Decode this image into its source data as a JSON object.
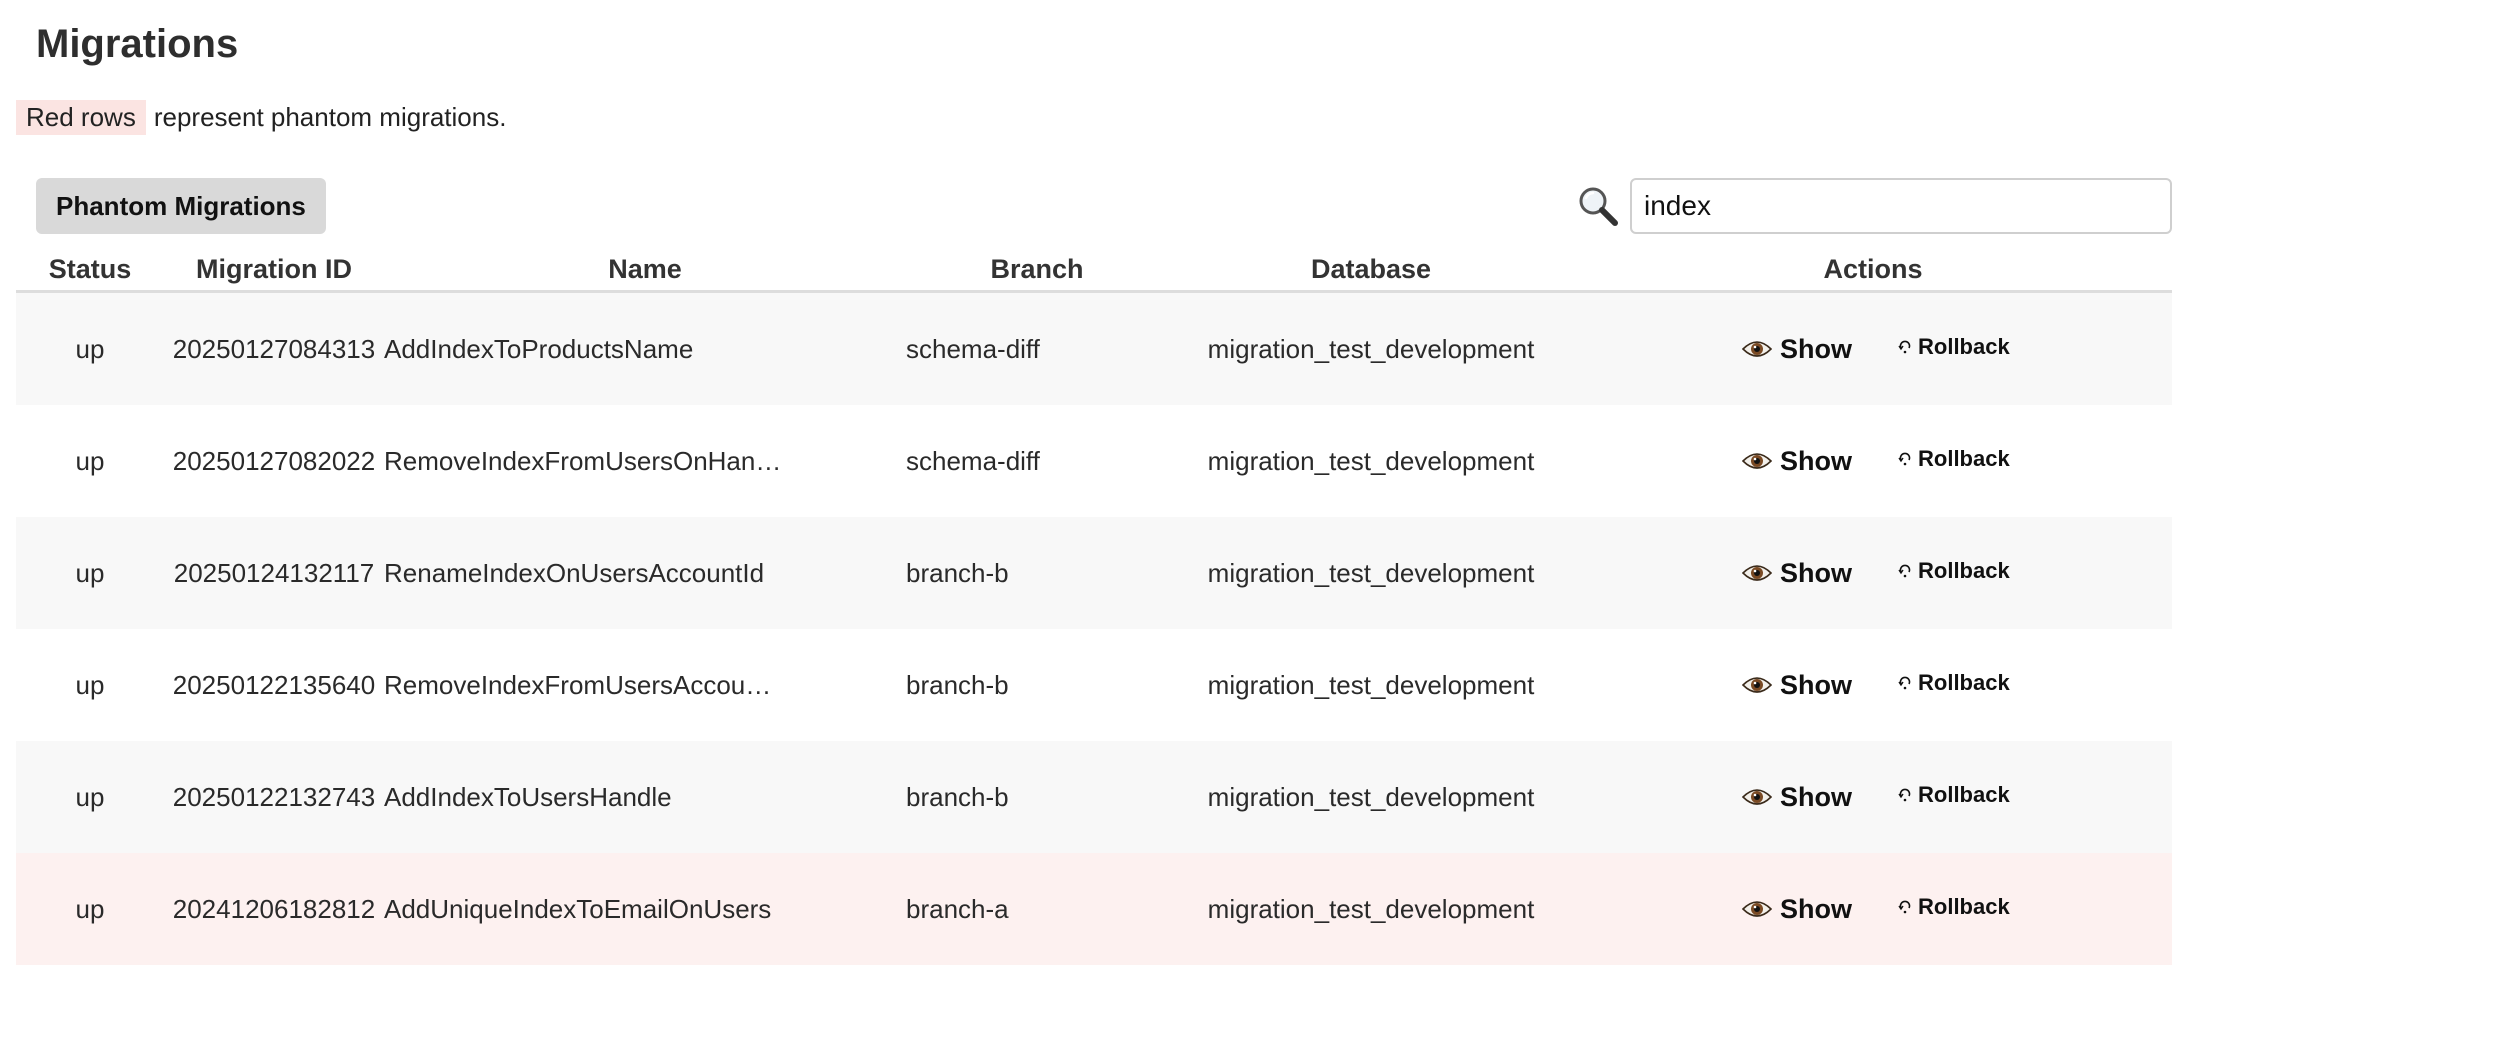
{
  "page": {
    "title": "Migrations",
    "legend_highlight": "Red rows",
    "legend_text": "represent phantom migrations.",
    "phantom_color": "#fbe4e2"
  },
  "toolbar": {
    "phantom_button_label": "Phantom Migrations",
    "search_icon": "search-icon",
    "search_value": "index"
  },
  "table": {
    "headers": {
      "status": "Status",
      "migration_id": "Migration ID",
      "name": "Name",
      "branch": "Branch",
      "database": "Database",
      "actions": "Actions"
    },
    "rows": [
      {
        "status": "up",
        "migration_id": "20250127084313",
        "name": "AddIndexToProductsName",
        "branch": "schema-diff",
        "database": "migration_test_development",
        "show_label": "Show",
        "rollback_label": "Rollback",
        "phantom": false
      },
      {
        "status": "up",
        "migration_id": "20250127082022",
        "name": "RemoveIndexFromUsersOnHan…",
        "branch": "schema-diff",
        "database": "migration_test_development",
        "show_label": "Show",
        "rollback_label": "Rollback",
        "phantom": false
      },
      {
        "status": "up",
        "migration_id": "20250124132117",
        "name": "RenameIndexOnUsersAccountId",
        "branch": "branch-b",
        "database": "migration_test_development",
        "show_label": "Show",
        "rollback_label": "Rollback",
        "phantom": false
      },
      {
        "status": "up",
        "migration_id": "20250122135640",
        "name": "RemoveIndexFromUsersAccou…",
        "branch": "branch-b",
        "database": "migration_test_development",
        "show_label": "Show",
        "rollback_label": "Rollback",
        "phantom": false
      },
      {
        "status": "up",
        "migration_id": "20250122132743",
        "name": "AddIndexToUsersHandle",
        "branch": "branch-b",
        "database": "migration_test_development",
        "show_label": "Show",
        "rollback_label": "Rollback",
        "phantom": false
      },
      {
        "status": "up",
        "migration_id": "20241206182812",
        "name": "AddUniqueIndexToEmailOnUsers",
        "branch": "branch-a",
        "database": "migration_test_development",
        "show_label": "Show",
        "rollback_label": "Rollback",
        "phantom": true
      }
    ],
    "icons": {
      "show": "eye-icon",
      "rollback": "rollback-icon"
    }
  }
}
